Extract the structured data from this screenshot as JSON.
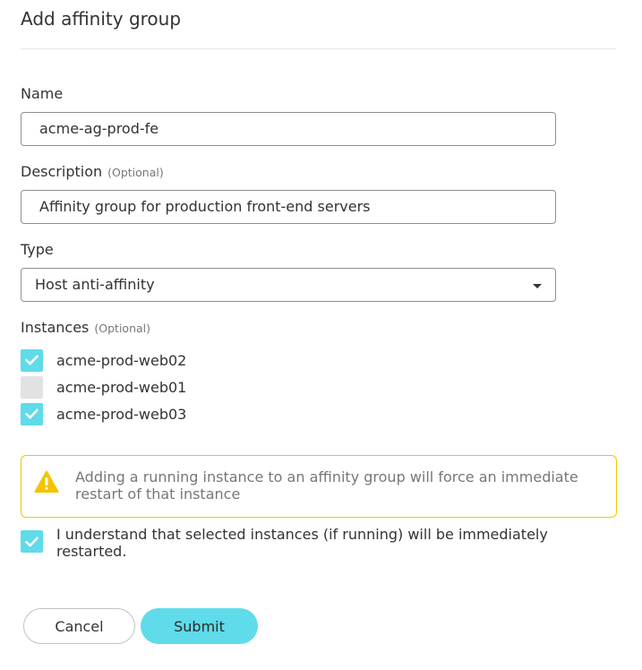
{
  "dialog": {
    "title": "Add affinity group"
  },
  "form": {
    "name": {
      "label": "Name",
      "value": "acme-ag-prod-fe"
    },
    "description": {
      "label": "Description",
      "optional": "(Optional)",
      "value": "Affinity group for production front-end servers"
    },
    "type": {
      "label": "Type",
      "value": "Host anti-affinity"
    },
    "instances": {
      "label": "Instances",
      "optional": "(Optional)",
      "items": [
        {
          "label": "acme-prod-web02",
          "checked": true
        },
        {
          "label": "acme-prod-web01",
          "checked": false
        },
        {
          "label": "acme-prod-web03",
          "checked": true
        }
      ]
    },
    "warning": {
      "text": "Adding a running instance to an affinity group will force an immediate restart of that instance"
    },
    "acknowledge": {
      "text": "I understand that selected instances (if running) will be immediately restarted.",
      "checked": true
    }
  },
  "actions": {
    "cancel_label": "Cancel",
    "submit_label": "Submit"
  },
  "colors": {
    "accent": "#5fdbe9",
    "warning": "#f2c400",
    "border": "#8f8f8f"
  },
  "icons": {
    "warning": "warning-triangle-icon",
    "check": "check-icon",
    "dropdown": "caret-down-icon"
  }
}
